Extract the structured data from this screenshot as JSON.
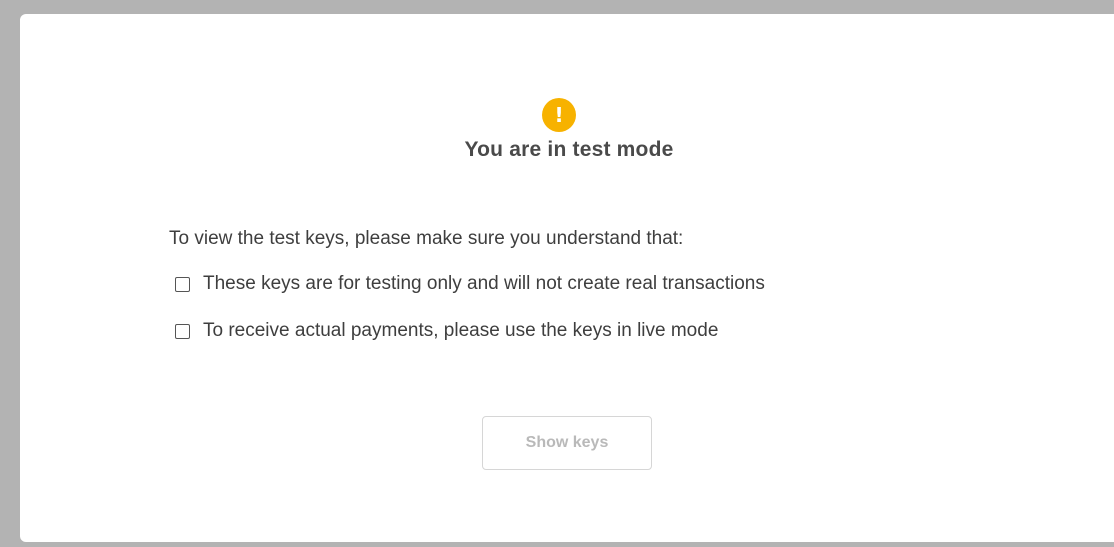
{
  "dialog": {
    "icon": "exclamation-icon",
    "icon_glyph": "!",
    "icon_color": "#f7b200",
    "title": "You are in test mode",
    "intro": "To view the test keys, please make sure you understand that:",
    "checkboxes": [
      {
        "label": "These keys are for testing only and will not create real transactions",
        "checked": false
      },
      {
        "label": "To receive actual payments, please use the keys in live mode",
        "checked": false
      }
    ],
    "button": {
      "label": "Show keys",
      "disabled": true
    }
  }
}
